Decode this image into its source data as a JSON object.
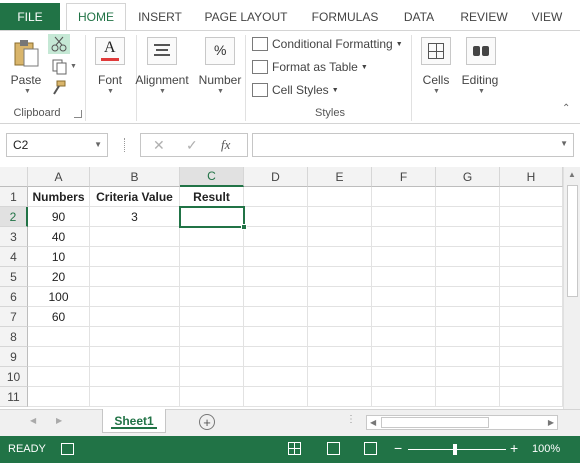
{
  "ribbon_tabs": {
    "file": "FILE",
    "home": "HOME",
    "insert": "INSERT",
    "page_layout": "PAGE LAYOUT",
    "formulas": "FORMULAS",
    "data": "DATA",
    "review": "REVIEW",
    "view": "VIEW"
  },
  "ribbon": {
    "paste": "Paste",
    "clipboard_group": "Clipboard",
    "font": "Font",
    "font_icon_glyph": "A",
    "alignment": "Alignment",
    "number": "Number",
    "number_icon_glyph": "%",
    "conditional_formatting": "Conditional Formatting",
    "format_as_table": "Format as Table",
    "cell_styles": "Cell Styles",
    "styles_group": "Styles",
    "cells": "Cells",
    "editing": "Editing"
  },
  "formula_bar": {
    "name_box": "C2",
    "cancel_glyph": "✕",
    "enter_glyph": "✓",
    "fx_glyph": "fx",
    "formula": ""
  },
  "columns": [
    "A",
    "B",
    "C",
    "D",
    "E",
    "F",
    "G",
    "H"
  ],
  "rows": [
    "1",
    "2",
    "3",
    "4",
    "5",
    "6",
    "7",
    "8",
    "9",
    "10",
    "11"
  ],
  "cells": {
    "A1": "Numbers",
    "B1": "Criteria Value",
    "C1": "Result",
    "A2": "90",
    "B2": "3",
    "A3": "40",
    "A4": "10",
    "A5": "20",
    "A6": "100",
    "A7": "60"
  },
  "selected_cell": "C2",
  "sheet_tabs": {
    "active": "Sheet1",
    "add_glyph": "+"
  },
  "status_bar": {
    "ready": "READY",
    "zoom": "100%"
  },
  "colors": {
    "accent": "#217346"
  }
}
